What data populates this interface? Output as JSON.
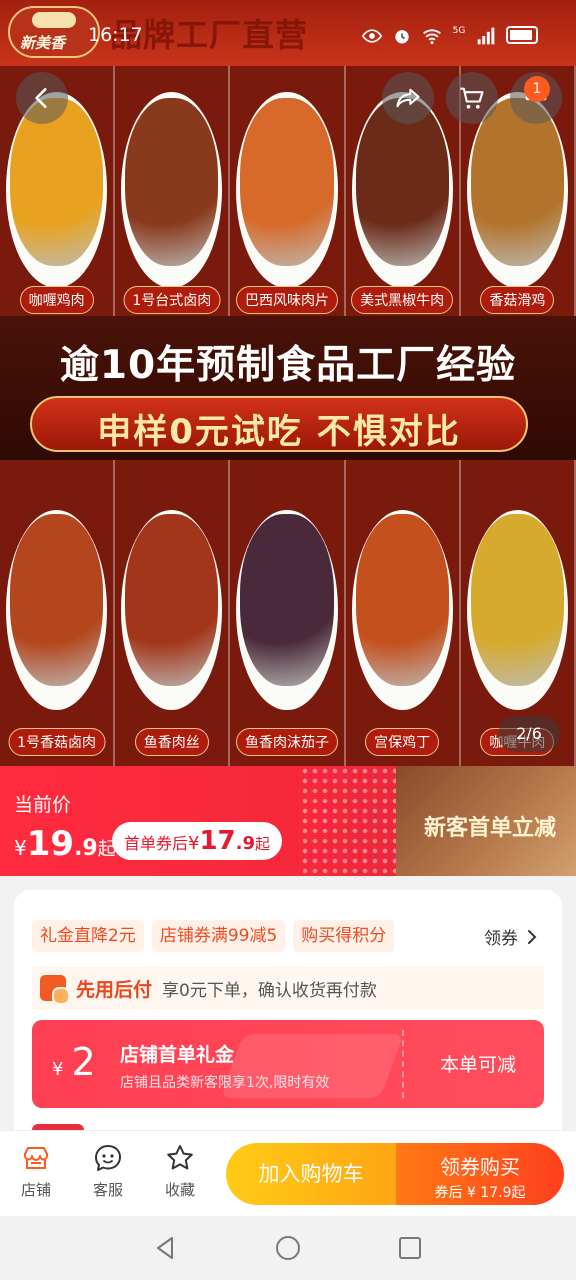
{
  "status_bar": {
    "time": "16:17",
    "network_label": "5G"
  },
  "hero": {
    "brand_name": "新美香",
    "brand_slogan": "品牌工厂直营",
    "top_dishes": [
      "咖喱鸡肉",
      "1号台式卤肉",
      "巴西风味肉片",
      "美式黑椒牛肉",
      "香菇滑鸡"
    ],
    "bottom_dishes": [
      "1号香菇卤肉",
      "鱼香肉丝",
      "鱼香肉沫茄子",
      "宫保鸡丁",
      "咖喱牛肉"
    ],
    "headline": "逾10年预制食品工厂经验",
    "subheadline": "申样0元试吃 不惧对比",
    "page_indicator": "2/6",
    "cart_badge": "1",
    "dish_colors": {
      "top": [
        "#e8a21f",
        "#8a3a1c",
        "#d76a2a",
        "#6b2b18",
        "#b2742c"
      ],
      "bottom": [
        "#b4461d",
        "#a3361a",
        "#4a2a3a",
        "#c4501e",
        "#d6aa2c"
      ]
    }
  },
  "price": {
    "current_label": "当前价",
    "currency": "¥",
    "price_int": "19",
    "price_dec": ".9",
    "price_suffix": "起",
    "coupon_label": "首单券后",
    "coupon_int": "17",
    "coupon_dec": ".9",
    "coupon_suffix": "起",
    "promo_text": "新客首单立减"
  },
  "info": {
    "tags": [
      "礼金直降2元",
      "店铺券满99减5",
      "购买得积分"
    ],
    "claim_coupon": "领券",
    "bnpl_title": "先用后付",
    "bnpl_desc": "享0元下单，确认收货再付款",
    "voucher": {
      "currency": "¥",
      "amount": "2",
      "title": "店铺首单礼金",
      "desc": "店铺且品类新客限享1次,限时有效",
      "action": "本单可减"
    }
  },
  "action_bar": {
    "store": "店铺",
    "service": "客服",
    "favorite": "收藏",
    "add_cart": "加入购物车",
    "buy_main": "领券购买",
    "buy_sub": "券后 ¥ 17.9起"
  },
  "colors": {
    "accent_red": "#f6283a",
    "coupon_orange": "#ef4b20",
    "add_cart_yellow": "#ffb814",
    "buy_orange": "#ff5a1a"
  }
}
